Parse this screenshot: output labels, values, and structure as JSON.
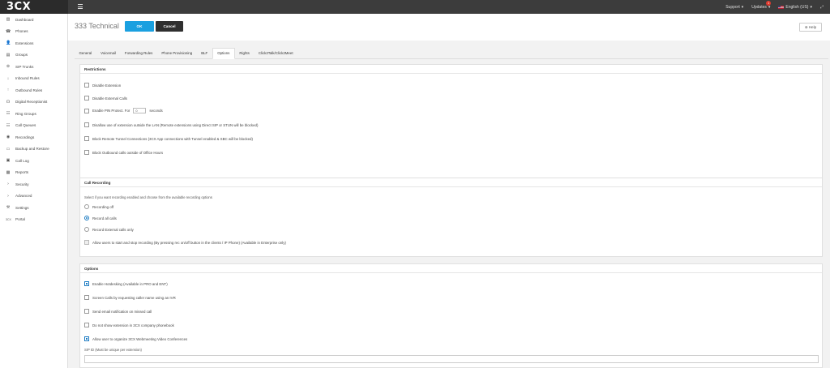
{
  "app": {
    "logo": "3CX"
  },
  "topbar": {
    "support_label": "Support",
    "updates_label": "Updates",
    "updates_count": "1",
    "language_label": "English (US)"
  },
  "sidebar": {
    "items": [
      {
        "label": "Dashboard",
        "icon": "dashboard-icon",
        "glyph": "▥"
      },
      {
        "label": "Phones",
        "icon": "phones-icon",
        "glyph": "☎"
      },
      {
        "label": "Extensions",
        "icon": "extensions-icon",
        "glyph": "👤"
      },
      {
        "label": "Groups",
        "icon": "groups-icon",
        "glyph": "▤"
      },
      {
        "label": "SIP Trunks",
        "icon": "sip-trunks-icon",
        "glyph": "⊚"
      },
      {
        "label": "Inbound Rules",
        "icon": "inbound-rules-icon",
        "glyph": "↓"
      },
      {
        "label": "Outbound Rules",
        "icon": "outbound-rules-icon",
        "glyph": "↑"
      },
      {
        "label": "Digital Receptionist",
        "icon": "digital-receptionist-icon",
        "glyph": "☊"
      },
      {
        "label": "Ring Groups",
        "icon": "ring-groups-icon",
        "glyph": "☷"
      },
      {
        "label": "Call Queues",
        "icon": "call-queues-icon",
        "glyph": "☷"
      },
      {
        "label": "Recordings",
        "icon": "recordings-icon",
        "glyph": "◉"
      },
      {
        "label": "Backup and Restore",
        "icon": "backup-restore-icon",
        "glyph": "▭"
      },
      {
        "label": "Call Log",
        "icon": "call-log-icon",
        "glyph": "▣"
      },
      {
        "label": "Reports",
        "icon": "reports-icon",
        "glyph": "▦"
      },
      {
        "label": "Security",
        "icon": "security-chevron-icon",
        "glyph": "›"
      },
      {
        "label": "Advanced",
        "icon": "advanced-chevron-icon",
        "glyph": "›"
      },
      {
        "label": "Settings",
        "icon": "settings-wrench-icon",
        "glyph": "⚒"
      },
      {
        "label": "Portal",
        "icon": "portal-3cx-icon",
        "glyph": "3CX"
      }
    ]
  },
  "header": {
    "title": "333 Technical",
    "ok_label": "OK",
    "cancel_label": "Cancel",
    "help_label": "Help"
  },
  "tabs": [
    {
      "label": "General",
      "active": false
    },
    {
      "label": "Voicemail",
      "active": false
    },
    {
      "label": "Forwarding Rules",
      "active": false
    },
    {
      "label": "Phone Provisioning",
      "active": false
    },
    {
      "label": "BLF",
      "active": false
    },
    {
      "label": "Options",
      "active": true
    },
    {
      "label": "Rights",
      "active": false
    },
    {
      "label": "Click2Talk/Click2Meet",
      "active": false
    }
  ],
  "restrictions": {
    "title": "Restrictions",
    "disable_extension": "Disable Extension",
    "disable_external_calls": "Disable External Calls",
    "pin_protect_prefix": "Enable PIN Protect. For",
    "pin_protect_value": "0",
    "pin_protect_suffix": "seconds",
    "disallow_outside_lan": "Disallow use of extension outside the LAN (Remote extensions using Direct SIP or STUN will be blocked)",
    "block_tunnel": "Block Remote Tunnel Connections (3CX App connections with Tunnel enabled & SBC will be blocked)",
    "block_outbound": "Block Outbound calls outside of Office Hours"
  },
  "call_recording": {
    "title": "Call Recording",
    "description": "Select if you want recording enabled and choose from the available recording options",
    "option_off": "Recording off",
    "option_all": "Record all calls",
    "option_external": "Record External calls only",
    "allow_start_stop": "Allow users to start and stop recording (By pressing rec on/off button in the clients / IP Phone) (Available in Enterprise only)"
  },
  "options": {
    "title": "Options",
    "hotdesking": "Enable Hotdesking (Available in PRO and ENT)",
    "screen_calls": "Screen Calls by requesting caller name using an IVR",
    "email_missed": "Send email notification on missed call",
    "hide_phonebook": "Do not show extension in 3CX company phonebook",
    "webmeeting": "Allow user to organize 3CX Webmeeting Video Conferences",
    "sip_id_label": "SIP ID (Must be unique per extension)"
  },
  "colors": {
    "accent": "#1aa0e0",
    "topbar": "#3c3c3c",
    "badge": "#e03a2f"
  }
}
